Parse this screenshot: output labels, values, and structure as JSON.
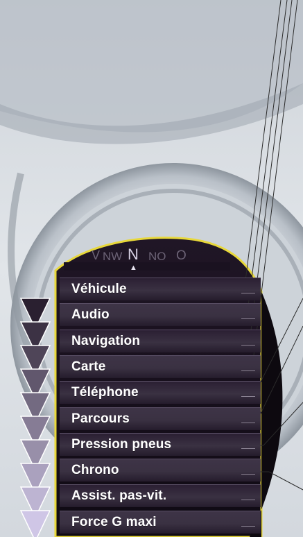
{
  "compass": {
    "labels": [
      {
        "id": "w",
        "text": "V"
      },
      {
        "id": "nw",
        "text": "NW"
      },
      {
        "id": "n",
        "text": "N"
      },
      {
        "id": "no",
        "text": "NO"
      },
      {
        "id": "o",
        "text": "O"
      }
    ],
    "heading_marker": "▲"
  },
  "menu": {
    "items": [
      {
        "label": "Véhicule"
      },
      {
        "label": "Audio"
      },
      {
        "label": "Navigation"
      },
      {
        "label": "Carte"
      },
      {
        "label": "Téléphone"
      },
      {
        "label": "Parcours"
      },
      {
        "label": "Pression pneus"
      },
      {
        "label": "Chrono"
      },
      {
        "label": "Assist. pas-vit."
      },
      {
        "label": "Force G maxi"
      }
    ]
  },
  "colors": {
    "display_border": "#e8d83a",
    "row_dark": "#2b1f33",
    "row_light": "#3e3447",
    "arrow_dark": "#2a2030",
    "arrow_light": "#cfc6e6",
    "dashboard_gray": "#b8bfc8"
  }
}
